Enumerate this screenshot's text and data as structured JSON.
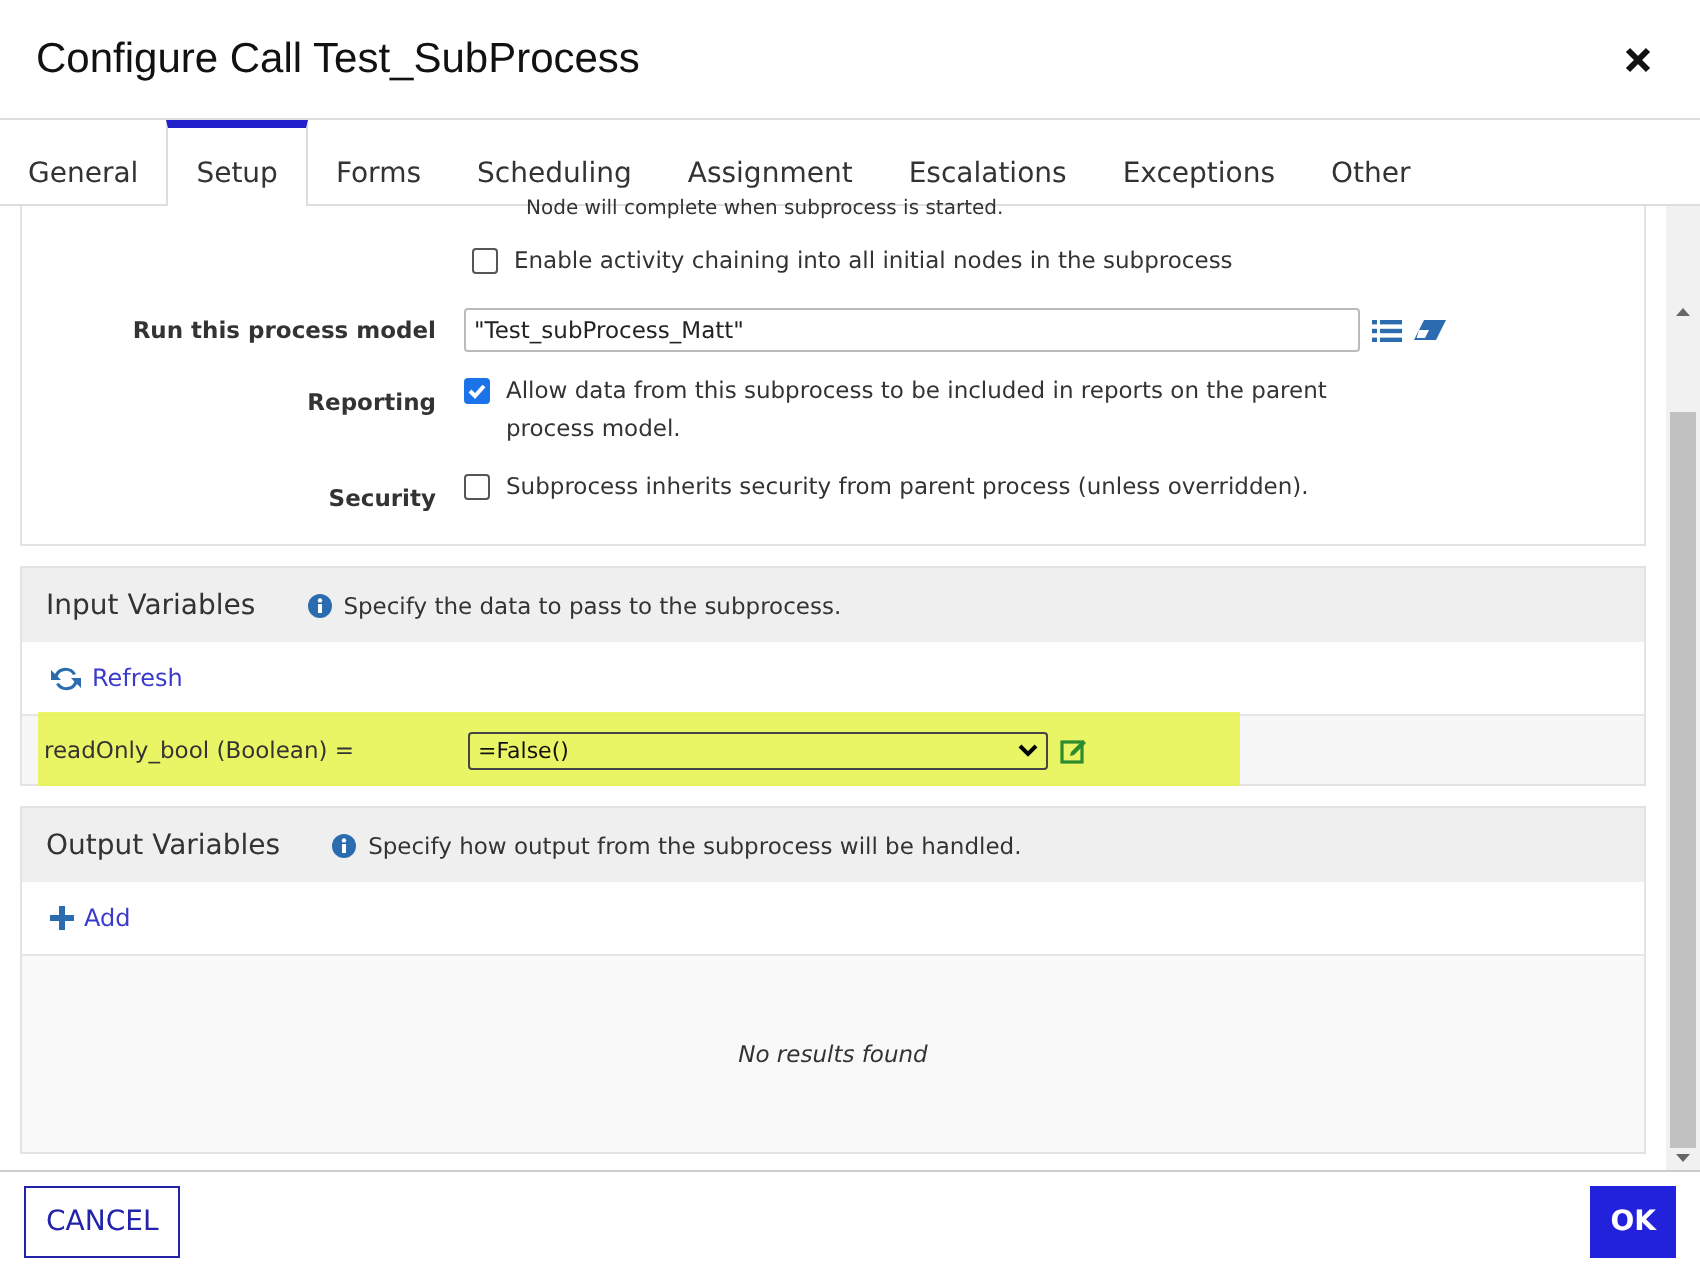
{
  "window": {
    "title": "Configure Call Test_SubProcess"
  },
  "tabs": [
    {
      "label": "General",
      "selected": false
    },
    {
      "label": "Setup",
      "selected": true
    },
    {
      "label": "Forms",
      "selected": false
    },
    {
      "label": "Scheduling",
      "selected": false
    },
    {
      "label": "Assignment",
      "selected": false
    },
    {
      "label": "Escalations",
      "selected": false
    },
    {
      "label": "Exceptions",
      "selected": false
    },
    {
      "label": "Other",
      "selected": false
    }
  ],
  "setup": {
    "note": "Node will complete when subprocess is started.",
    "chaining": {
      "label": "Enable activity chaining into all initial nodes in the subprocess",
      "checked": false
    },
    "fields": [
      {
        "kind": "picker",
        "label": "Run this process model",
        "value": "\"Test_subProcess_Matt\""
      },
      {
        "kind": "checkbox",
        "label": "Reporting",
        "text": "Allow data from this subprocess to be included in reports on the parent process model.",
        "checked": true
      },
      {
        "kind": "checkbox",
        "label": "Security",
        "text": "Subprocess inherits security from parent process (unless overridden).",
        "checked": false
      }
    ]
  },
  "input_variables": {
    "title": "Input Variables",
    "hint": "Specify the data to pass to the subprocess.",
    "action": "Refresh",
    "rows": [
      {
        "name": "readOnly_bool (Boolean) =",
        "value": "=False()",
        "highlighted": true
      }
    ]
  },
  "output_variables": {
    "title": "Output Variables",
    "hint": "Specify how output from the subprocess will be handled.",
    "action": "Add",
    "empty": "No results found"
  },
  "buttons": {
    "cancel": "CANCEL",
    "ok": "OK"
  }
}
